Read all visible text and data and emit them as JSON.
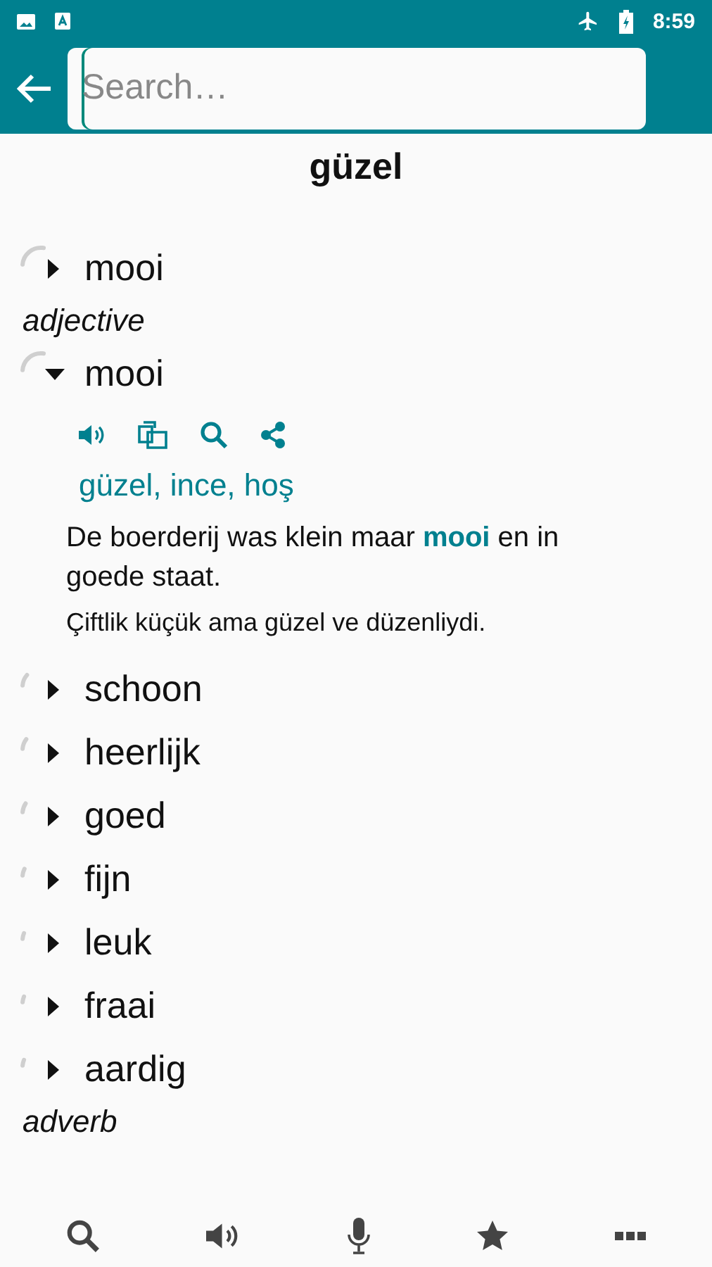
{
  "status_bar": {
    "time": "8:59"
  },
  "search": {
    "placeholder": "Search…"
  },
  "headword": "güzel",
  "sections": [
    {
      "entries": [
        {
          "word": "mooi",
          "expanded": false
        }
      ]
    },
    {
      "pos": "adjective",
      "entries": [
        {
          "word": "mooi",
          "expanded": true,
          "translations": "güzel, ince, hoş",
          "example": "De boerderij was klein maar **mooi** en in goede staat.",
          "example_translation": "Çiftlik küçük ama güzel ve düzenliydi."
        },
        {
          "word": "schoon",
          "expanded": false
        },
        {
          "word": "heerlijk",
          "expanded": false
        },
        {
          "word": "goed",
          "expanded": false
        },
        {
          "word": "fijn",
          "expanded": false
        },
        {
          "word": "leuk",
          "expanded": false
        },
        {
          "word": "fraai",
          "expanded": false
        },
        {
          "word": "aardig",
          "expanded": false
        }
      ]
    },
    {
      "pos": "adverb"
    }
  ]
}
